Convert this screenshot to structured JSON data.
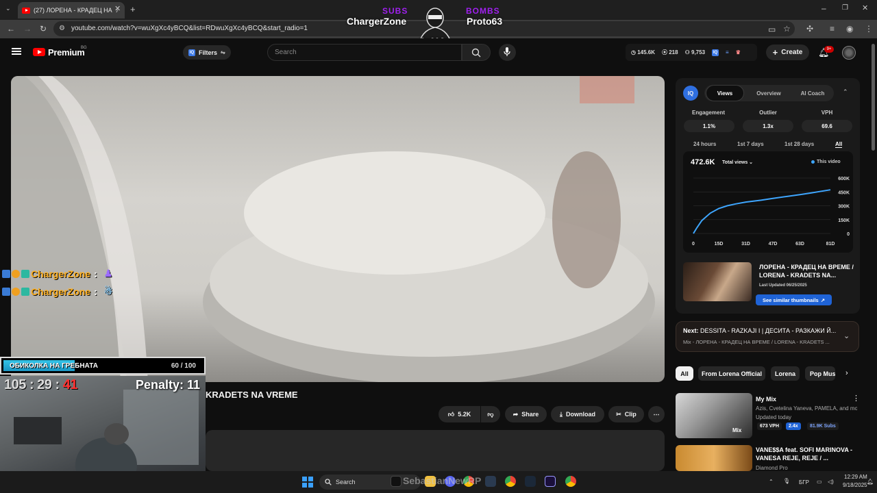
{
  "browser": {
    "tab_title": "(27) ЛОРЕНА - КРАДЕЦ НА",
    "url": "youtube.com/watch?v=wuXgXc4yBCQ&list=RDwuXgXc4yBCQ&start_radio=1"
  },
  "overlay": {
    "subs_label": "SUBS",
    "bombs_label": "BOMBS",
    "subs_name": "ChargerZone",
    "bombs_name": "Proto63",
    "count": "2.1K",
    "chat": [
      {
        "user": "ChargerZone",
        "sep": ":"
      },
      {
        "user": "ChargerZone",
        "sep": ":"
      }
    ],
    "progress": {
      "label": "ОБИКОЛКА НА ГРЕБНАТА",
      "current": 60,
      "total": 100,
      "count_text": "60 / 100"
    },
    "timer": {
      "h": "105",
      "m": "29",
      "s": "41",
      "sep": ":"
    },
    "penalty": "Penalty: 11"
  },
  "header": {
    "brand": "Premium",
    "country": "BG",
    "filters_label": "Filters",
    "search_placeholder": "Search",
    "stats": {
      "views": "145.6K",
      "likes": "218",
      "subs": "9,753"
    },
    "create_label": "Create",
    "notifications": "9+"
  },
  "video": {
    "title_partial": "KRADETS NA VREME",
    "likes": "5.2K",
    "share": "Share",
    "download": "Download",
    "clip": "Clip"
  },
  "panel": {
    "tabs": [
      "Views",
      "Overview",
      "AI Coach"
    ],
    "metrics": [
      {
        "label": "Engagement",
        "value": "1.1%"
      },
      {
        "label": "Outlier",
        "value": "1.3x"
      },
      {
        "label": "VPH",
        "value": "69.6"
      }
    ],
    "ranges": [
      "24 hours",
      "1st 7 days",
      "1st 28 days",
      "All"
    ],
    "total_views": "472.6K",
    "views_select": "Total views",
    "legend": "This video",
    "thumb_title": "ЛОРЕНА - КРАДЕЦ НА ВРЕМЕ / LORENA - KRADETS NA...",
    "thumb_updated": "Last Updated 06/25/2025",
    "see_similar": "See similar thumbnails"
  },
  "chart_data": {
    "type": "line",
    "x_ticks": [
      "0",
      "15D",
      "31D",
      "47D",
      "63D",
      "81D"
    ],
    "y_ticks": [
      "0",
      "150K",
      "300K",
      "450K",
      "600K"
    ],
    "ylim": [
      0,
      600000
    ],
    "xlim": [
      0,
      81
    ],
    "x": [
      0,
      2,
      5,
      10,
      15,
      20,
      25,
      31,
      40,
      47,
      55,
      63,
      70,
      75,
      81
    ],
    "y": [
      0,
      60000,
      140000,
      220000,
      270000,
      300000,
      320000,
      340000,
      360000,
      380000,
      400000,
      420000,
      440000,
      455000,
      472600
    ]
  },
  "next": {
    "label": "Next:",
    "title": "DESSITA - RAZKAJI I | ДЕСИТА - РАЗКАЖИ Й...",
    "subtitle": "Mix - ЛОРЕНА - КРАДЕЦ НА ВРЕМЕ / LORENA - KRADETS ..."
  },
  "chips": [
    "All",
    "From Lorena Official",
    "Lorena",
    "Pop Mus"
  ],
  "recs": [
    {
      "title": "My Mix",
      "sub": "Azis, Cvetelina Yaneva, PAMELA, and mo...",
      "sub2": "Updated today",
      "vph": "673 VPH",
      "mult": "2.4x",
      "subs": "81.9K Subs",
      "overlay": "Mix"
    },
    {
      "title": "VANE$$A feat. SOFI MARINOVA - VANESA REJE, REJE / ...",
      "sub": "Diamond Pro"
    }
  ],
  "taskbar": {
    "search": "Search",
    "watermark": "SebastianNewRP",
    "lang": "БГР",
    "time": "12:29 AM",
    "date": "9/18/2025"
  }
}
